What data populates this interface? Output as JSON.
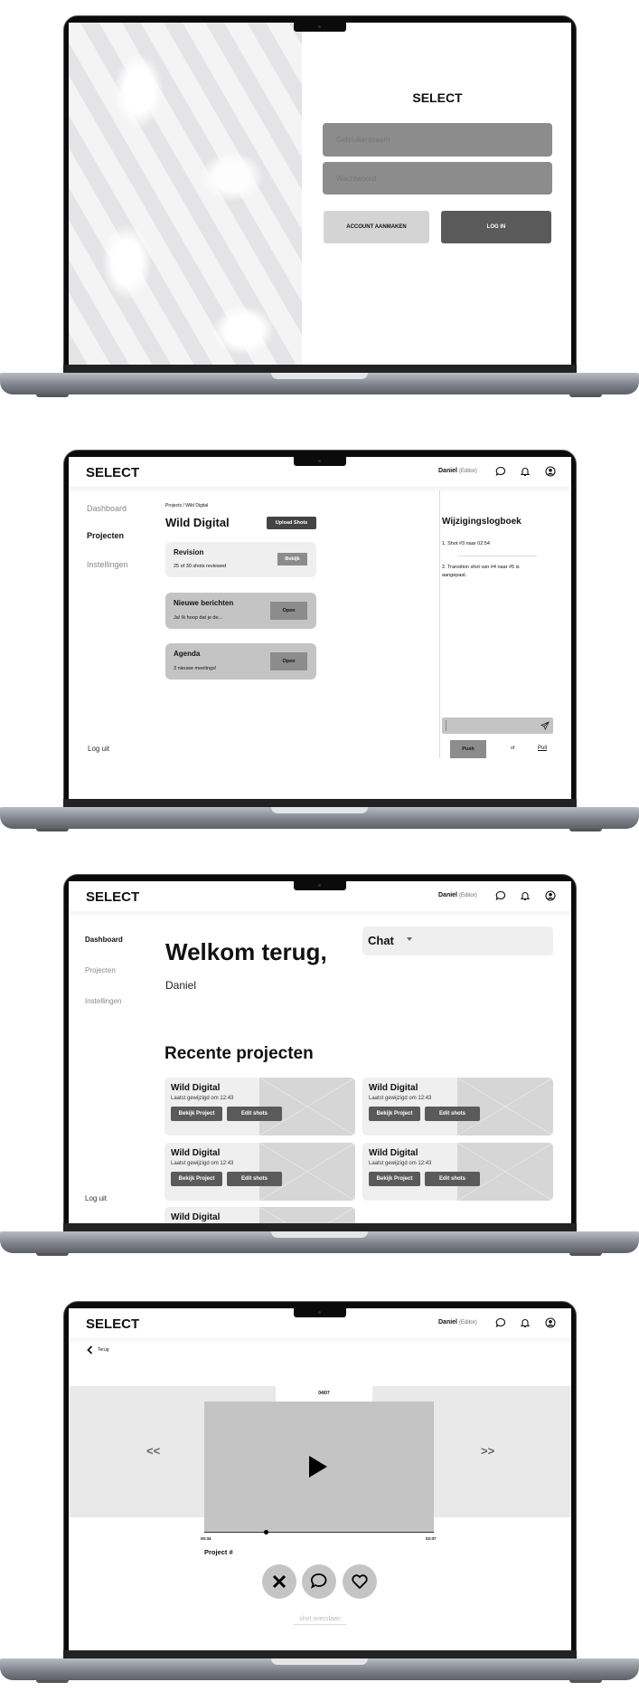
{
  "login": {
    "logo": "SELECT",
    "username_placeholder": "Gebruikersnaam",
    "password_placeholder": "Wachtwoord",
    "create_account_label": "ACCOUNT AANMAKEN",
    "login_label": "LOG IN"
  },
  "header": {
    "logo": "SELECT",
    "user_name": "Daniel",
    "user_role": "(Editor)",
    "icons": [
      "chat-icon",
      "bell-icon",
      "user-icon"
    ]
  },
  "sidebar": {
    "items": [
      {
        "label": "Dashboard"
      },
      {
        "label": "Projecten"
      },
      {
        "label": "Instellingen"
      }
    ],
    "logout": "Log uit"
  },
  "project_page": {
    "breadcrumb": "Projects / Wild Digital",
    "title": "Wild Digital",
    "upload_label": "Upload Shots",
    "cards": [
      {
        "title": "Revision",
        "subtitle": "25 of 30 shots reviewed",
        "button": "Bekijk"
      },
      {
        "title": "Nieuwe berichten",
        "subtitle": "Ja! Ik hoop dat je de...",
        "button": "Open"
      },
      {
        "title": "Agenda",
        "subtitle": "3 nieuwe meetings!",
        "button": "Open"
      }
    ],
    "changelog": {
      "title": "Wijzigingslogboek",
      "items": [
        "1. Shot #3 naar 02:54",
        "2. Transition shot van #4 naar #5 is aangepast."
      ],
      "input_placeholder": "",
      "push_label": "Push",
      "or_label": "of",
      "pull_label": "Pull"
    }
  },
  "dashboard": {
    "welcome": "Welkom terug,",
    "name": "Daniel",
    "chat_label": "Chat",
    "recent_title": "Recente projecten",
    "projects": [
      {
        "title": "Wild Digital",
        "subtitle": "Laatst gewijzigd om 12:43",
        "view": "Bekijk Project",
        "edit": "Edit shots"
      },
      {
        "title": "Wild Digital",
        "subtitle": "Laatst gewijzigd om 12:43",
        "view": "Bekijk Project",
        "edit": "Edit shots"
      },
      {
        "title": "Wild Digital",
        "subtitle": "Laatst gewijzigd om 12:43",
        "view": "Bekijk Project",
        "edit": "Edit shots"
      },
      {
        "title": "Wild Digital",
        "subtitle": "Laatst gewijzigd om 12:43",
        "view": "Bekijk Project",
        "edit": "Edit shots"
      },
      {
        "title": "Wild Digital"
      }
    ]
  },
  "player": {
    "back_label": "Terug",
    "counter": "04/07",
    "prev": "<<",
    "next": ">>",
    "time_current": "00:34",
    "time_total": "02:07",
    "progress": 0.27,
    "project_label": "Project #",
    "skip_label": "shot overslaan"
  }
}
